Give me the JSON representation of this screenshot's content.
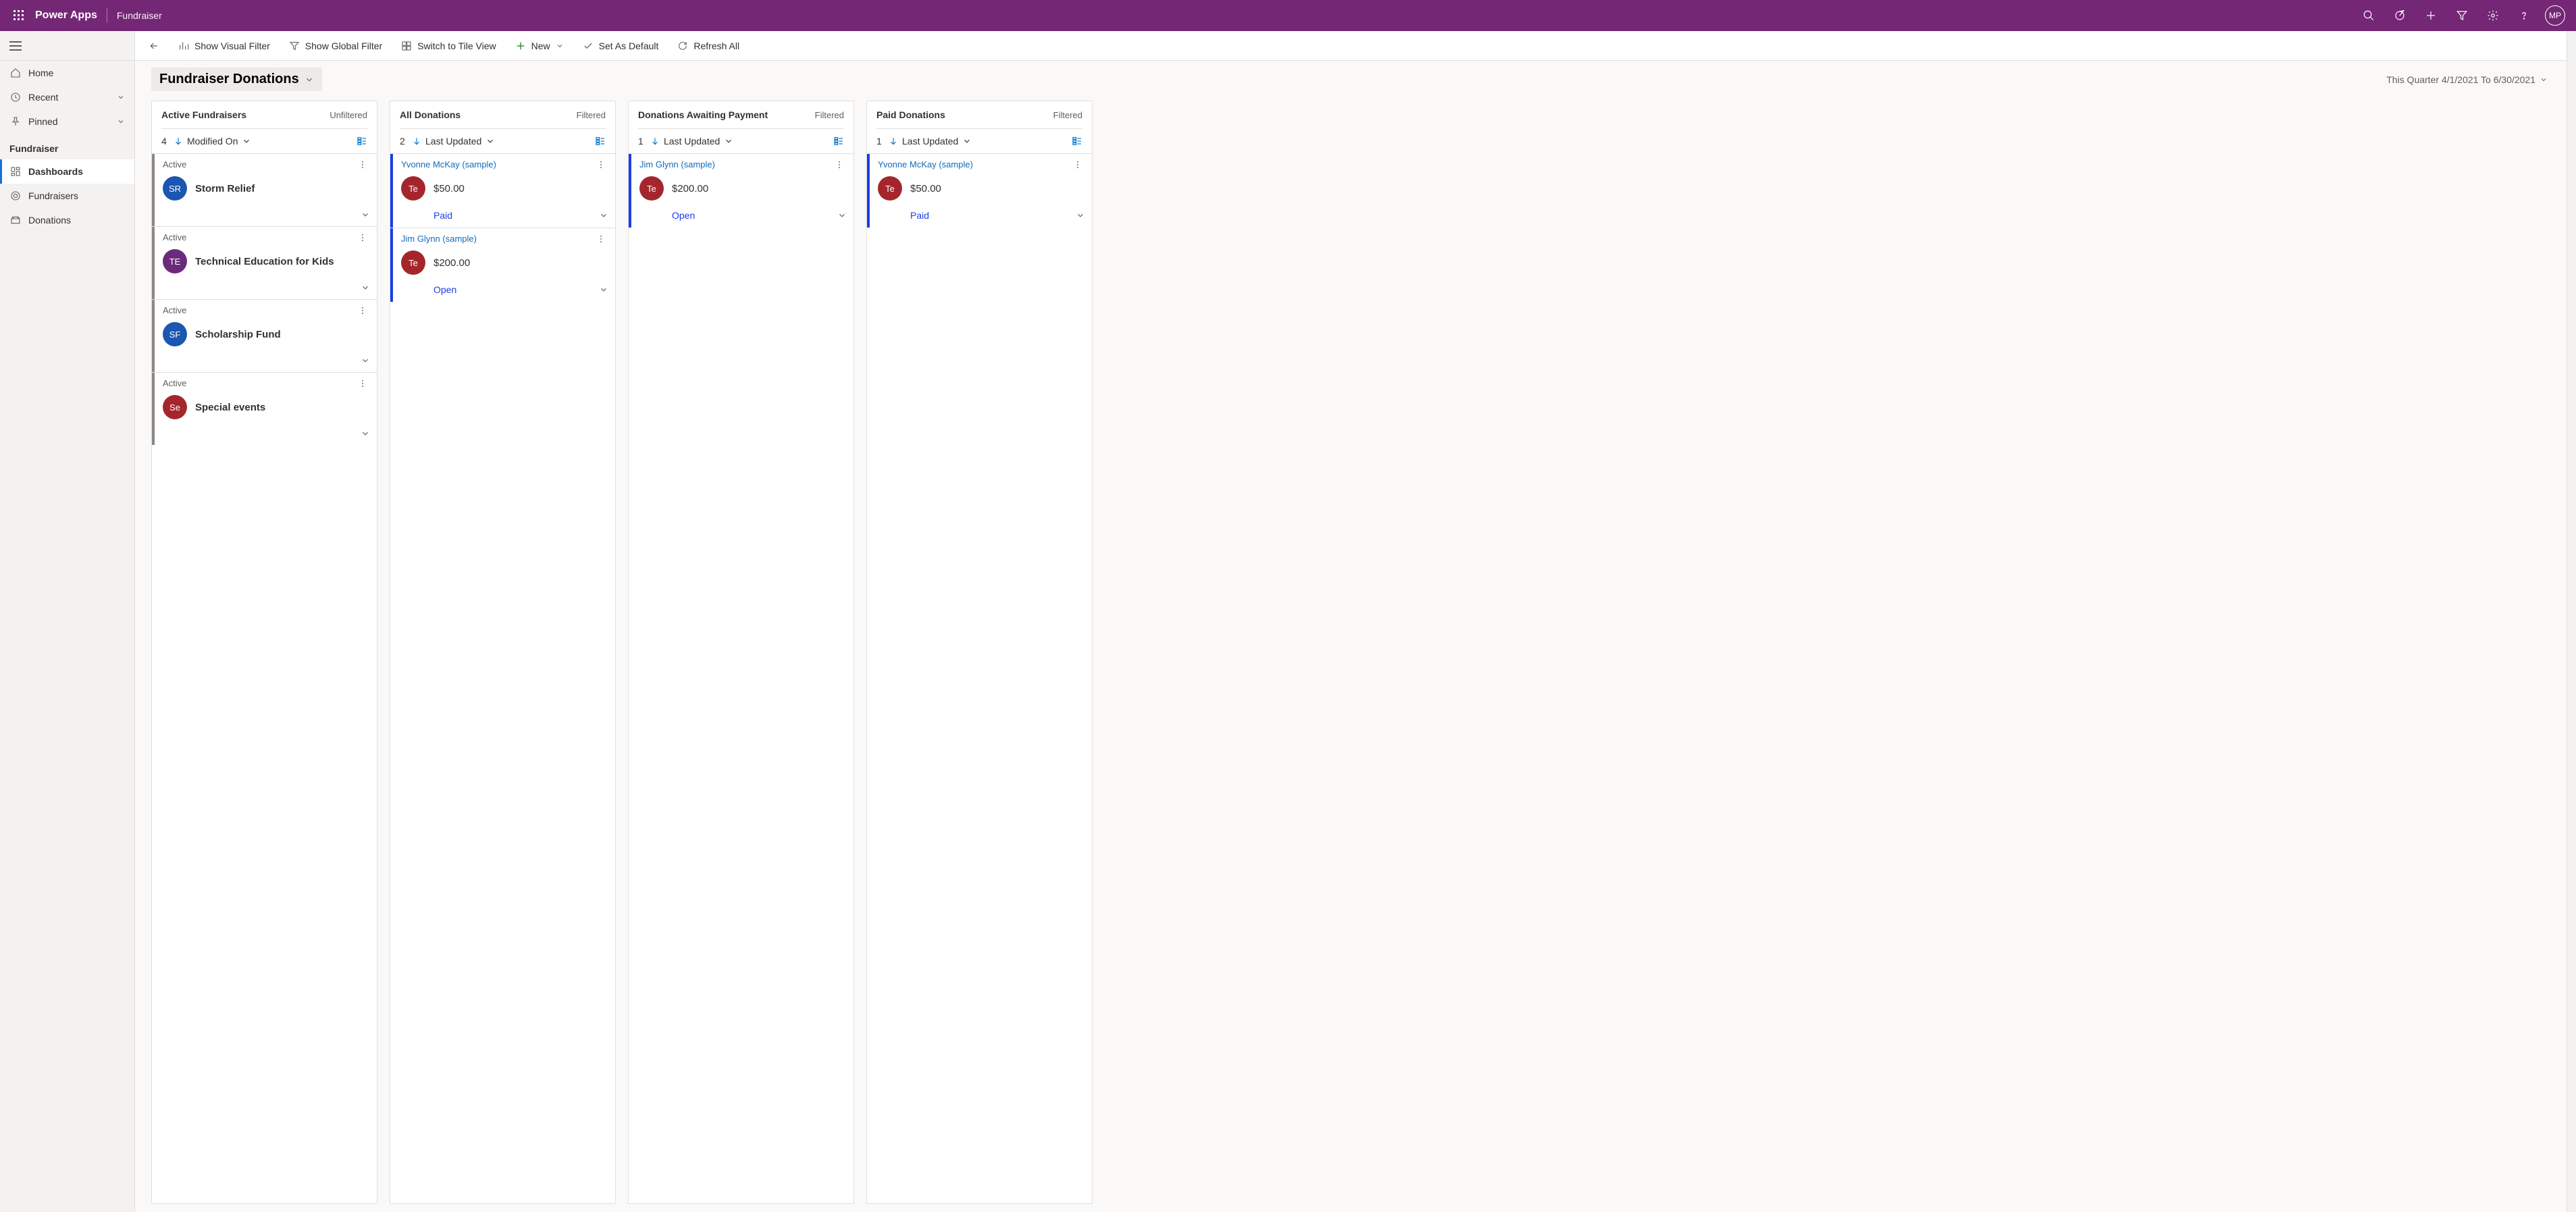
{
  "topbar": {
    "brand": "Power Apps",
    "appname": "Fundraiser",
    "avatar_initials": "MP"
  },
  "leftnav": {
    "home": "Home",
    "recent": "Recent",
    "pinned": "Pinned",
    "section_label": "Fundraiser",
    "dashboards": "Dashboards",
    "fundraisers": "Fundraisers",
    "donations": "Donations"
  },
  "cmdbar": {
    "visual_filter": "Show Visual Filter",
    "global_filter": "Show Global Filter",
    "tile_view": "Switch to Tile View",
    "new": "New",
    "set_default": "Set As Default",
    "refresh": "Refresh All"
  },
  "page": {
    "view_title": "Fundraiser Donations",
    "date_range": "This Quarter 4/1/2021 To 6/30/2021"
  },
  "streams": [
    {
      "title": "Active Fundraisers",
      "filter_state": "Unfiltered",
      "count": "4",
      "sort_by": "Modified On",
      "type": "fundraiser",
      "cards": [
        {
          "status_label": "Active",
          "circle": "SR",
          "circle_color": "blue",
          "title": "Storm Relief"
        },
        {
          "status_label": "Active",
          "circle": "TE",
          "circle_color": "purple",
          "title": "Technical Education for Kids"
        },
        {
          "status_label": "Active",
          "circle": "SF",
          "circle_color": "blue",
          "title": "Scholarship Fund"
        },
        {
          "status_label": "Active",
          "circle": "Se",
          "circle_color": "red",
          "title": "Special events"
        }
      ]
    },
    {
      "title": "All Donations",
      "filter_state": "Filtered",
      "count": "2",
      "sort_by": "Last Updated",
      "type": "donation",
      "cards": [
        {
          "link_top": "Yvonne McKay (sample)",
          "circle": "Te",
          "circle_color": "red",
          "amount": "$50.00",
          "status_link": "Paid"
        },
        {
          "link_top": "Jim Glynn (sample)",
          "circle": "Te",
          "circle_color": "red",
          "amount": "$200.00",
          "status_link": "Open"
        }
      ]
    },
    {
      "title": "Donations Awaiting Payment",
      "filter_state": "Filtered",
      "count": "1",
      "sort_by": "Last Updated",
      "type": "donation",
      "cards": [
        {
          "link_top": "Jim Glynn (sample)",
          "circle": "Te",
          "circle_color": "red",
          "amount": "$200.00",
          "status_link": "Open"
        }
      ]
    },
    {
      "title": "Paid Donations",
      "filter_state": "Filtered",
      "count": "1",
      "sort_by": "Last Updated",
      "type": "donation",
      "cards": [
        {
          "link_top": "Yvonne McKay (sample)",
          "circle": "Te",
          "circle_color": "red",
          "amount": "$50.00",
          "status_link": "Paid"
        }
      ]
    }
  ]
}
